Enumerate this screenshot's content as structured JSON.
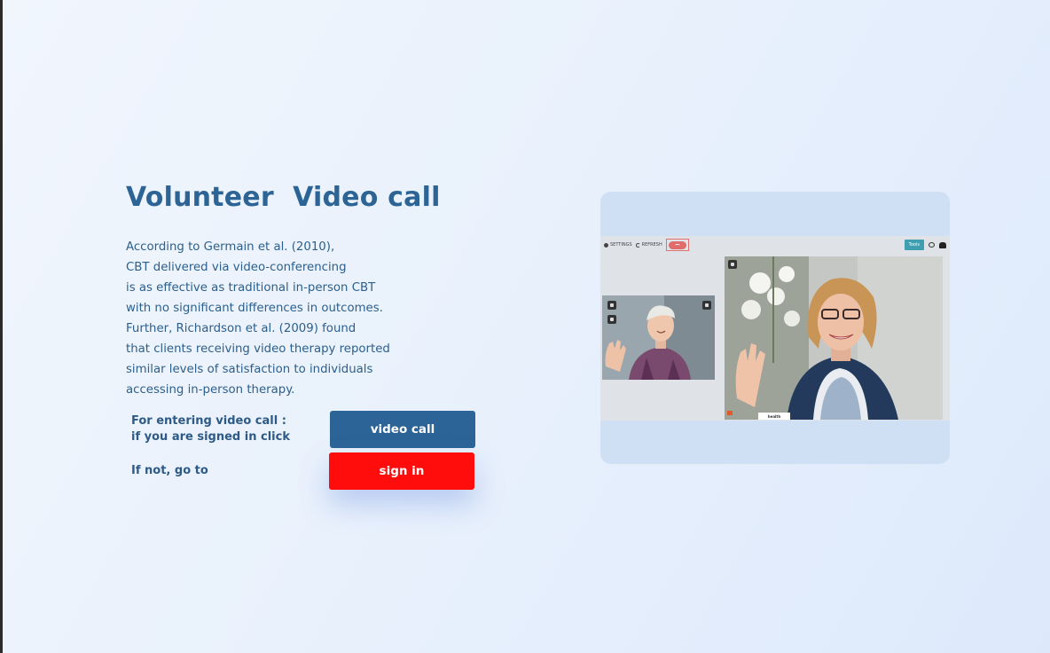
{
  "heading": "Volunteer  Video call",
  "paragraph_lines": [
    "According to Germain et al. (2010),",
    "CBT delivered via video-conferencing",
    "is as effective as traditional in-person CBT",
    "with no significant differences in outcomes.",
    "Further, Richardson et al. (2009) found",
    "that clients receiving video therapy reported",
    "similar levels of satisfaction to individuals",
    "accessing in-person therapy."
  ],
  "entry": {
    "label_line1": "For entering video call :",
    "label_line2": "if you are signed in click",
    "button_label": "video call"
  },
  "signin": {
    "label": "If not, go to",
    "button_label": "sign in"
  },
  "screenshot": {
    "settings_label": "SETTINGS",
    "refresh_label": "REFRESH",
    "tools_label": "Tools",
    "logo_text": "health"
  },
  "colors": {
    "heading": "#2c6496",
    "video_button": "#2c6497",
    "signin_button": "#ff0d0d"
  }
}
